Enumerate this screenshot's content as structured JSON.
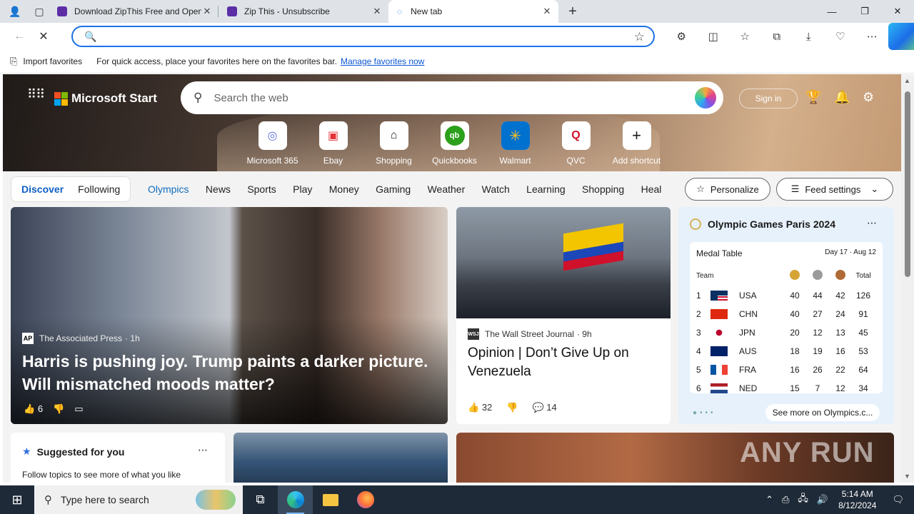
{
  "browser": {
    "tabs": [
      {
        "title": "Download ZipThis Free and Open"
      },
      {
        "title": "Zip This - Unsubscribe"
      },
      {
        "title": "New tab"
      }
    ],
    "window_controls": {
      "minimize": "—",
      "maximize": "❐",
      "close": "✕"
    },
    "address_placeholder": "",
    "favorites_bar": {
      "import_label": "Import favorites",
      "message": "For quick access, place your favorites here on the favorites bar.",
      "manage_link": "Manage favorites now"
    }
  },
  "start": {
    "brand": "Microsoft Start",
    "search_placeholder": "Search the web",
    "sign_in": "Sign in",
    "shortcuts": [
      {
        "label": "Microsoft 365",
        "glyph": "◎",
        "color": "#5a6fe0"
      },
      {
        "label": "Ebay",
        "glyph": "🛍",
        "color": "#e53238"
      },
      {
        "label": "Shopping",
        "glyph": "🏷",
        "color": "#222222"
      },
      {
        "label": "Quickbooks",
        "glyph": "qb",
        "color": "#2ca01c"
      },
      {
        "label": "Walmart",
        "glyph": "✳",
        "color": "#ffc220"
      },
      {
        "label": "QVC",
        "glyph": "Q",
        "color": "#d0112b"
      },
      {
        "label": "Add shortcut",
        "glyph": "+",
        "color": "#222222"
      }
    ],
    "toggle": {
      "discover": "Discover",
      "following": "Following"
    },
    "categories": [
      "Olympics",
      "News",
      "Sports",
      "Play",
      "Money",
      "Gaming",
      "Weather",
      "Watch",
      "Learning",
      "Shopping",
      "Heal"
    ],
    "personalize": "Personalize",
    "feed_settings": "Feed settings"
  },
  "cards": {
    "main": {
      "source": "The Associated Press",
      "age": "· 1h",
      "headline": "Harris is pushing joy. Trump paints a darker picture. Will mismatched moods matter?",
      "likes": "6"
    },
    "wsj": {
      "source": "The Wall Street Journal",
      "age": "· 9h",
      "headline": "Opinion | Don’t Give Up on Venezuela",
      "likes": "32",
      "comments": "14"
    },
    "olympics": {
      "title": "Olympic Games Paris 2024",
      "table_title": "Medal Table",
      "dates": "Day 17 · Aug 12",
      "team_header": "Team",
      "total_header": "Total",
      "rows": [
        {
          "rank": "1",
          "team": "USA",
          "gold": "40",
          "silver": "44",
          "bronze": "42",
          "total": "126"
        },
        {
          "rank": "2",
          "team": "CHN",
          "gold": "40",
          "silver": "27",
          "bronze": "24",
          "total": "91"
        },
        {
          "rank": "3",
          "team": "JPN",
          "gold": "20",
          "silver": "12",
          "bronze": "13",
          "total": "45"
        },
        {
          "rank": "4",
          "team": "AUS",
          "gold": "18",
          "silver": "19",
          "bronze": "16",
          "total": "53"
        },
        {
          "rank": "5",
          "team": "FRA",
          "gold": "16",
          "silver": "26",
          "bronze": "22",
          "total": "64"
        },
        {
          "rank": "6",
          "team": "NED",
          "gold": "15",
          "silver": "7",
          "bronze": "12",
          "total": "34"
        }
      ],
      "see_more": "See more on Olympics.c..."
    },
    "suggested": {
      "title": "Suggested for you",
      "subtitle": "Follow topics to see more of what you like"
    }
  },
  "watermark": "ANY RUN",
  "taskbar": {
    "search_placeholder": "Type here to search",
    "time": "5:14 AM",
    "date": "8/12/2024"
  },
  "colors": {
    "accent": "#1a73e8",
    "discover": "#0f5fc5",
    "taskbar": "#1f2a38"
  }
}
